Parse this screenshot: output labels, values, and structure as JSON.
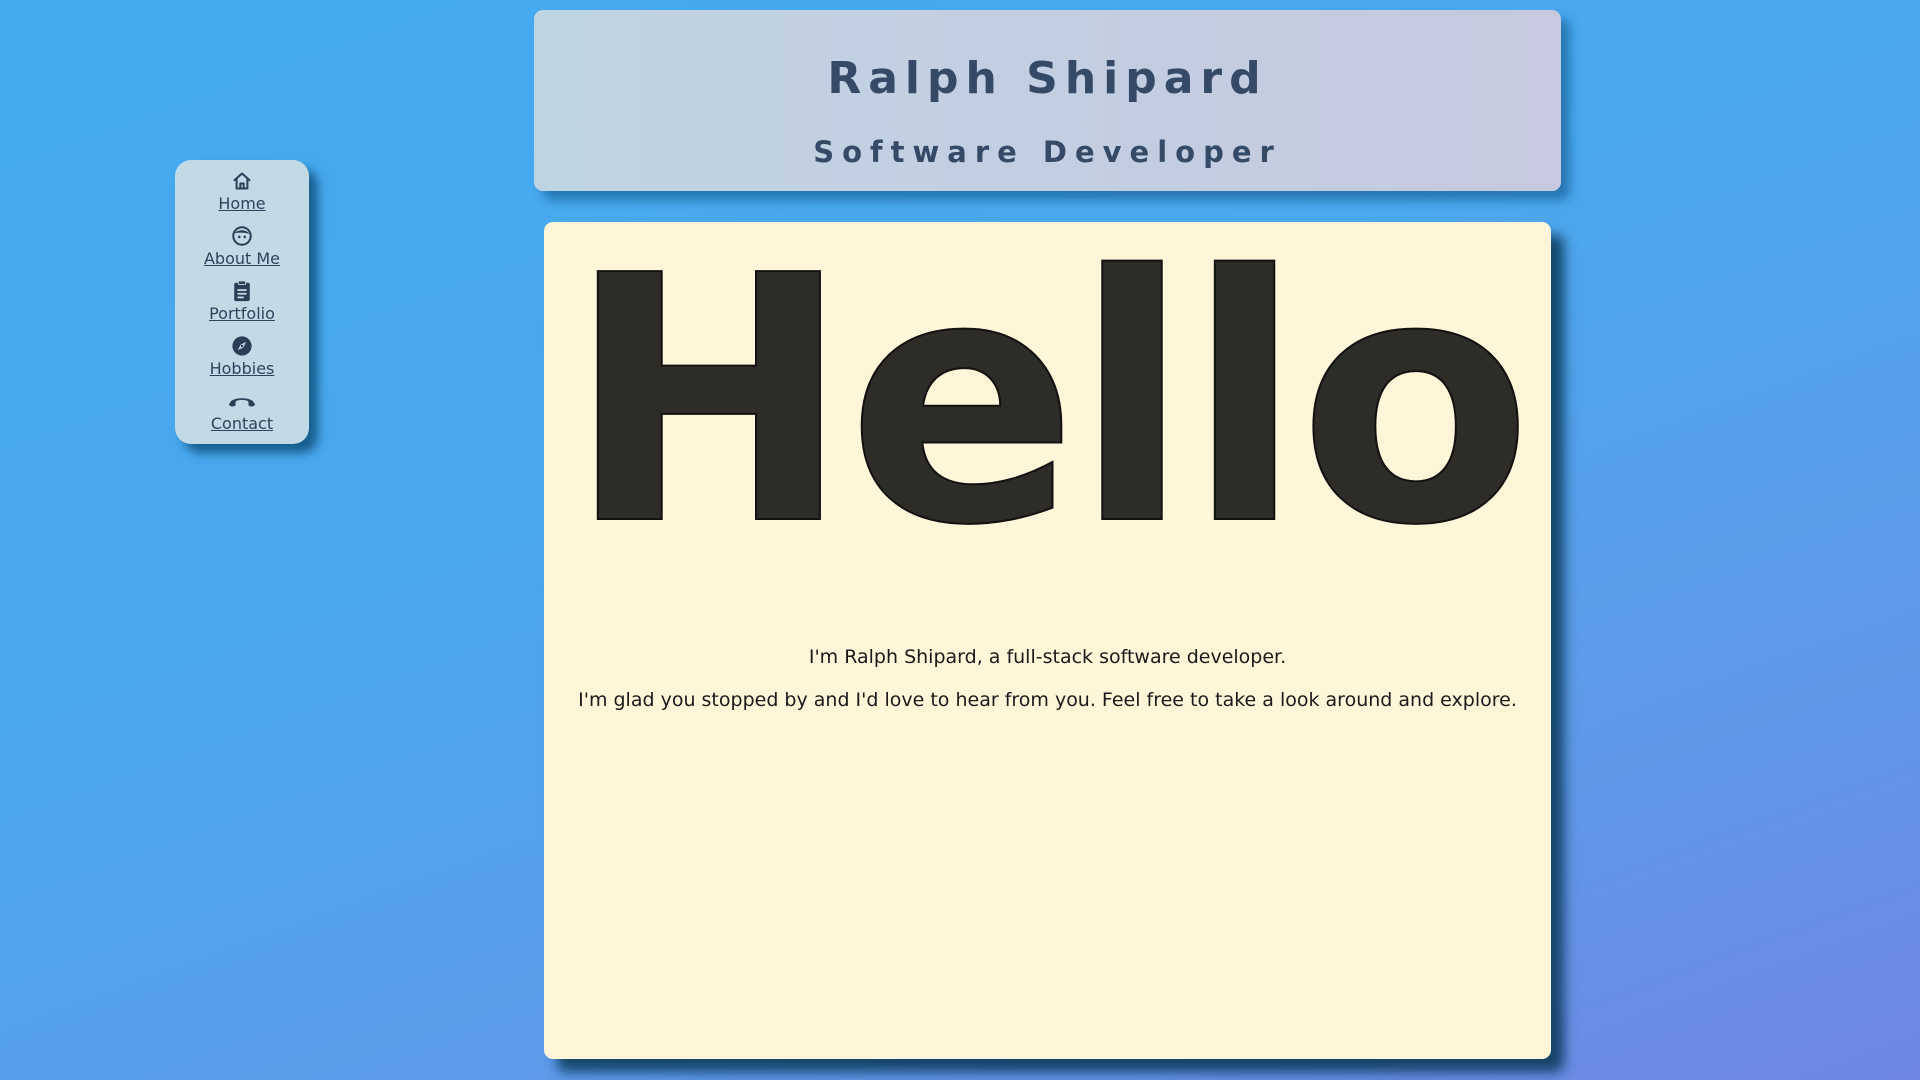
{
  "header": {
    "name": "Ralph Shipard",
    "subtitle": "Software Developer"
  },
  "nav": {
    "items": [
      {
        "label": "Home",
        "icon": "home-icon"
      },
      {
        "label": "About Me",
        "icon": "face-icon"
      },
      {
        "label": "Portfolio",
        "icon": "clipboard-icon"
      },
      {
        "label": "Hobbies",
        "icon": "compass-icon"
      },
      {
        "label": "Contact",
        "icon": "phone-icon"
      }
    ]
  },
  "main": {
    "greeting": "Hello",
    "intro_line_1": "I'm Ralph Shipard, a full-stack software developer.",
    "intro_line_2": "I'm glad you stopped by and I'd love to hear from you. Feel free to take a look around and explore."
  },
  "colors": {
    "background_start": "#43aaf0",
    "background_end": "#6e87e3",
    "sidebar_bg": "#c2d9e6",
    "header_text": "#344a66",
    "card_bg": "#fff5d9",
    "greeting_text": "#2e2c26"
  }
}
